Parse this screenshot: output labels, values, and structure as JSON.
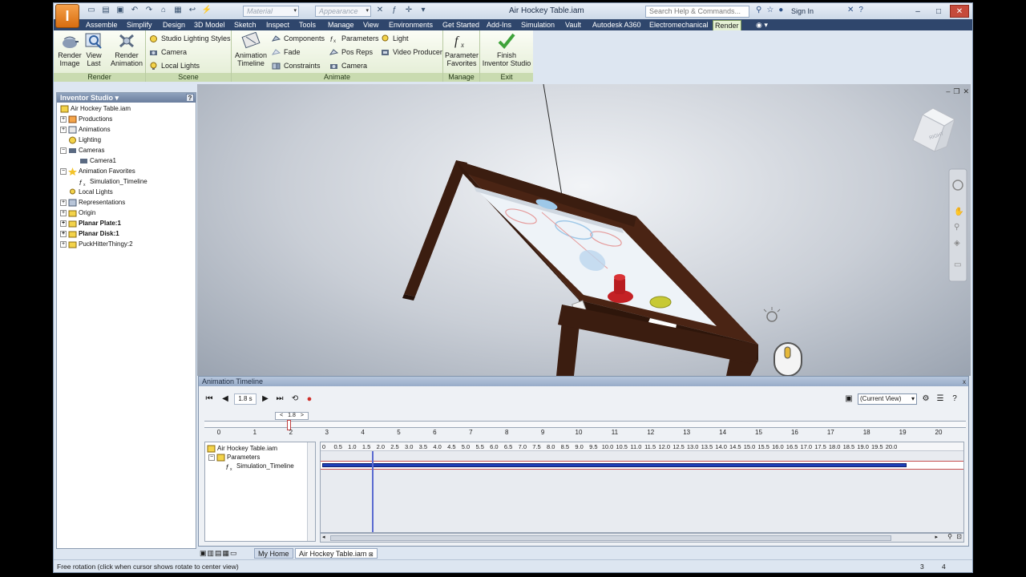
{
  "title_bar": {
    "app_logo": "I",
    "material_placeholder": "Material",
    "appearance_placeholder": "Appearance",
    "window_title": "Air Hockey Table.iam",
    "search_placeholder": "Search Help & Commands...",
    "sign_in": "Sign In",
    "win_min": "–",
    "win_max": "□",
    "win_close": "✕"
  },
  "tabs": [
    "Assemble",
    "Simplify",
    "Design",
    "3D Model",
    "Sketch",
    "Inspect",
    "Tools",
    "Manage",
    "View",
    "Environments",
    "Get Started",
    "Add-Ins",
    "Simulation",
    "Vault",
    "Autodesk A360",
    "Electromechanical",
    "Render"
  ],
  "active_tab": "Render",
  "ribbon": {
    "render_panel": {
      "label": "Render",
      "render_image": "Render\nImage",
      "view_last": "View\nLast",
      "render_animation": "Render\nAnimation"
    },
    "scene_panel": {
      "label": "Scene",
      "studio_lighting_styles": "Studio Lighting Styles",
      "camera": "Camera",
      "local_lights": "Local Lights"
    },
    "animate_panel": {
      "label": "Animate",
      "animation_timeline": "Animation\nTimeline",
      "components": "Components",
      "fade": "Fade",
      "constraints": "Constraints",
      "parameters": "Parameters",
      "pos_reps": "Pos Reps",
      "camera": "Camera",
      "light": "Light",
      "video_producer": "Video Producer"
    },
    "manage_panel": {
      "label": "Manage",
      "parameter_favorites": "Parameter\nFavorites"
    },
    "exit_panel": {
      "label": "Exit",
      "finish_inventor_studio": "Finish\nInventor Studio"
    }
  },
  "browser": {
    "title": "Inventor Studio ▾",
    "help": "?",
    "items": [
      {
        "label": "Air Hockey Table.iam",
        "bold": false
      },
      {
        "label": "Productions",
        "bold": false
      },
      {
        "label": "Animations",
        "bold": false
      },
      {
        "label": "Lighting",
        "bold": false
      },
      {
        "label": "Cameras",
        "bold": false
      },
      {
        "label": "Camera1",
        "bold": false
      },
      {
        "label": "Animation Favorites",
        "bold": false
      },
      {
        "label": "Simulation_Timeline",
        "bold": false
      },
      {
        "label": "Local Lights",
        "bold": false
      },
      {
        "label": "Representations",
        "bold": false
      },
      {
        "label": "Origin",
        "bold": false
      },
      {
        "label": "Planar Plate:1",
        "bold": true
      },
      {
        "label": "Planar Disk:1",
        "bold": true
      },
      {
        "label": "PuckHitterThingy:2",
        "bold": false
      }
    ]
  },
  "viewcube": {
    "face_label": "RIGHT"
  },
  "timeline": {
    "title": "Animation Timeline",
    "close": "x",
    "current_time": "1.8 s",
    "nudge_value": "1.8",
    "view_select": "(Current View)",
    "ruler_labels": [
      "0",
      "1",
      "2",
      "3",
      "4",
      "5",
      "6",
      "7",
      "8",
      "9",
      "10",
      "11",
      "12",
      "13",
      "14",
      "15",
      "16",
      "17",
      "18",
      "19",
      "20"
    ],
    "track_scale": [
      "0",
      "0.5",
      "1.0",
      "1.5",
      "2.0",
      "2.5",
      "3.0",
      "3.5",
      "4.0",
      "4.5",
      "5.0",
      "5.5",
      "6.0",
      "6.5",
      "7.0",
      "7.5",
      "8.0",
      "8.5",
      "9.0",
      "9.5",
      "10.0",
      "10.5",
      "11.0",
      "11.5",
      "12.0",
      "12.5",
      "13.0",
      "13.5",
      "14.0",
      "14.5",
      "15.0",
      "15.5",
      "16.0",
      "16.5",
      "17.0",
      "17.5",
      "18.0",
      "18.5",
      "19.0",
      "19.5",
      "20.0"
    ],
    "tree": [
      "Air Hockey Table.iam",
      "Parameters",
      "Simulation_Timeline"
    ],
    "track_end": 19.5,
    "track_total": 21.5
  },
  "doc_tabs": [
    "My Home",
    "Air Hockey Table.iam"
  ],
  "status": {
    "text": "Free rotation (click when cursor shows rotate to center view)",
    "num1": "3",
    "num2": "4"
  },
  "colors": {
    "ribbon_active": "#e5f1d4",
    "tab_bar": "#2f466c",
    "timeline_bar": "#1f3fb8",
    "record": "#d0302a",
    "table_wood": "#3b1d10"
  }
}
